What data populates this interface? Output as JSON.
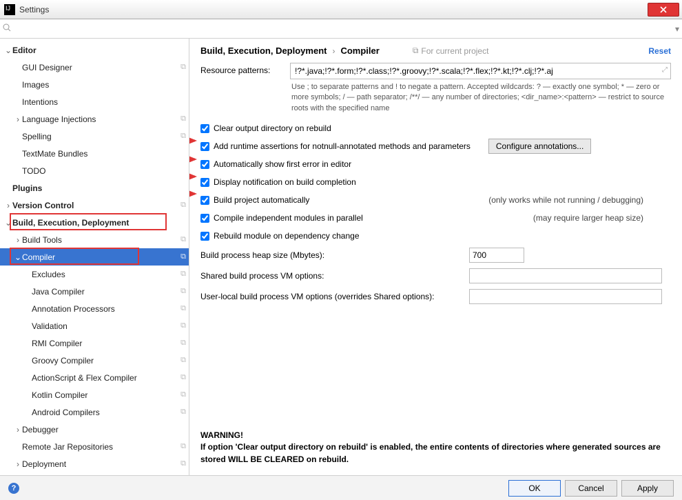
{
  "window": {
    "title": "Settings"
  },
  "search": {
    "placeholder": ""
  },
  "sidebar": {
    "items": [
      {
        "label": "Editor",
        "bold": true,
        "indent": 0,
        "arrow": "down",
        "proj": false
      },
      {
        "label": "GUI Designer",
        "indent": 1,
        "proj": true
      },
      {
        "label": "Images",
        "indent": 1
      },
      {
        "label": "Intentions",
        "indent": 1
      },
      {
        "label": "Language Injections",
        "indent": 1,
        "arrow": "right",
        "proj": true
      },
      {
        "label": "Spelling",
        "indent": 1,
        "proj": true
      },
      {
        "label": "TextMate Bundles",
        "indent": 1
      },
      {
        "label": "TODO",
        "indent": 1
      },
      {
        "label": "Plugins",
        "bold": true,
        "indent": 0
      },
      {
        "label": "Version Control",
        "bold": true,
        "indent": 0,
        "arrow": "right",
        "proj": true
      },
      {
        "label": "Build, Execution, Deployment",
        "bold": true,
        "indent": 0,
        "arrow": "down",
        "highlight": true
      },
      {
        "label": "Build Tools",
        "indent": 1,
        "arrow": "right",
        "proj": true
      },
      {
        "label": "Compiler",
        "indent": 1,
        "arrow": "down",
        "proj": true,
        "selected": true,
        "highlight": true
      },
      {
        "label": "Excludes",
        "indent": 2,
        "proj": true
      },
      {
        "label": "Java Compiler",
        "indent": 2,
        "proj": true
      },
      {
        "label": "Annotation Processors",
        "indent": 2,
        "proj": true
      },
      {
        "label": "Validation",
        "indent": 2,
        "proj": true
      },
      {
        "label": "RMI Compiler",
        "indent": 2,
        "proj": true
      },
      {
        "label": "Groovy Compiler",
        "indent": 2,
        "proj": true
      },
      {
        "label": "ActionScript & Flex Compiler",
        "indent": 2,
        "proj": true
      },
      {
        "label": "Kotlin Compiler",
        "indent": 2,
        "proj": true
      },
      {
        "label": "Android Compilers",
        "indent": 2,
        "proj": true
      },
      {
        "label": "Debugger",
        "indent": 1,
        "arrow": "right"
      },
      {
        "label": "Remote Jar Repositories",
        "indent": 1,
        "proj": true
      },
      {
        "label": "Deployment",
        "indent": 1,
        "arrow": "right",
        "proj": true
      }
    ]
  },
  "breadcrumb": {
    "part1": "Build, Execution, Deployment",
    "part2": "Compiler",
    "hint": "For current project",
    "reset": "Reset"
  },
  "form": {
    "resource_label": "Resource patterns:",
    "resource_value": "!?*.java;!?*.form;!?*.class;!?*.groovy;!?*.scala;!?*.flex;!?*.kt;!?*.clj;!?*.aj",
    "resource_hint": "Use ; to separate patterns and ! to negate a pattern. Accepted wildcards: ? — exactly one symbol; * — zero or more symbols; / — path separator; /**/ — any number of directories; <dir_name>:<pattern> — restrict to source roots with the specified name",
    "checks": [
      {
        "label": "Clear output directory on rebuild",
        "checked": true
      },
      {
        "label": "Add runtime assertions for notnull-annotated methods and parameters",
        "checked": true,
        "button": "Configure annotations..."
      },
      {
        "label": "Automatically show first error in editor",
        "checked": true,
        "arrow": true
      },
      {
        "label": "Display notification on build completion",
        "checked": true,
        "arrow": true
      },
      {
        "label": "Build project automatically",
        "checked": true,
        "note": "(only works while not running / debugging)",
        "arrow": true
      },
      {
        "label": "Compile independent modules in parallel",
        "checked": true,
        "note": "(may require larger heap size)",
        "arrow": true
      },
      {
        "label": "Rebuild module on dependency change",
        "checked": true
      }
    ],
    "heap_label": "Build process heap size (Mbytes):",
    "heap_value": "700",
    "shared_label": "Shared build process VM options:",
    "shared_value": "",
    "user_label": "User-local build process VM options (overrides Shared options):",
    "user_value": ""
  },
  "warning": {
    "title": "WARNING!",
    "body": "If option 'Clear output directory on rebuild' is enabled, the entire contents of directories where generated sources are stored WILL BE CLEARED on rebuild."
  },
  "footer": {
    "ok": "OK",
    "cancel": "Cancel",
    "apply": "Apply"
  }
}
